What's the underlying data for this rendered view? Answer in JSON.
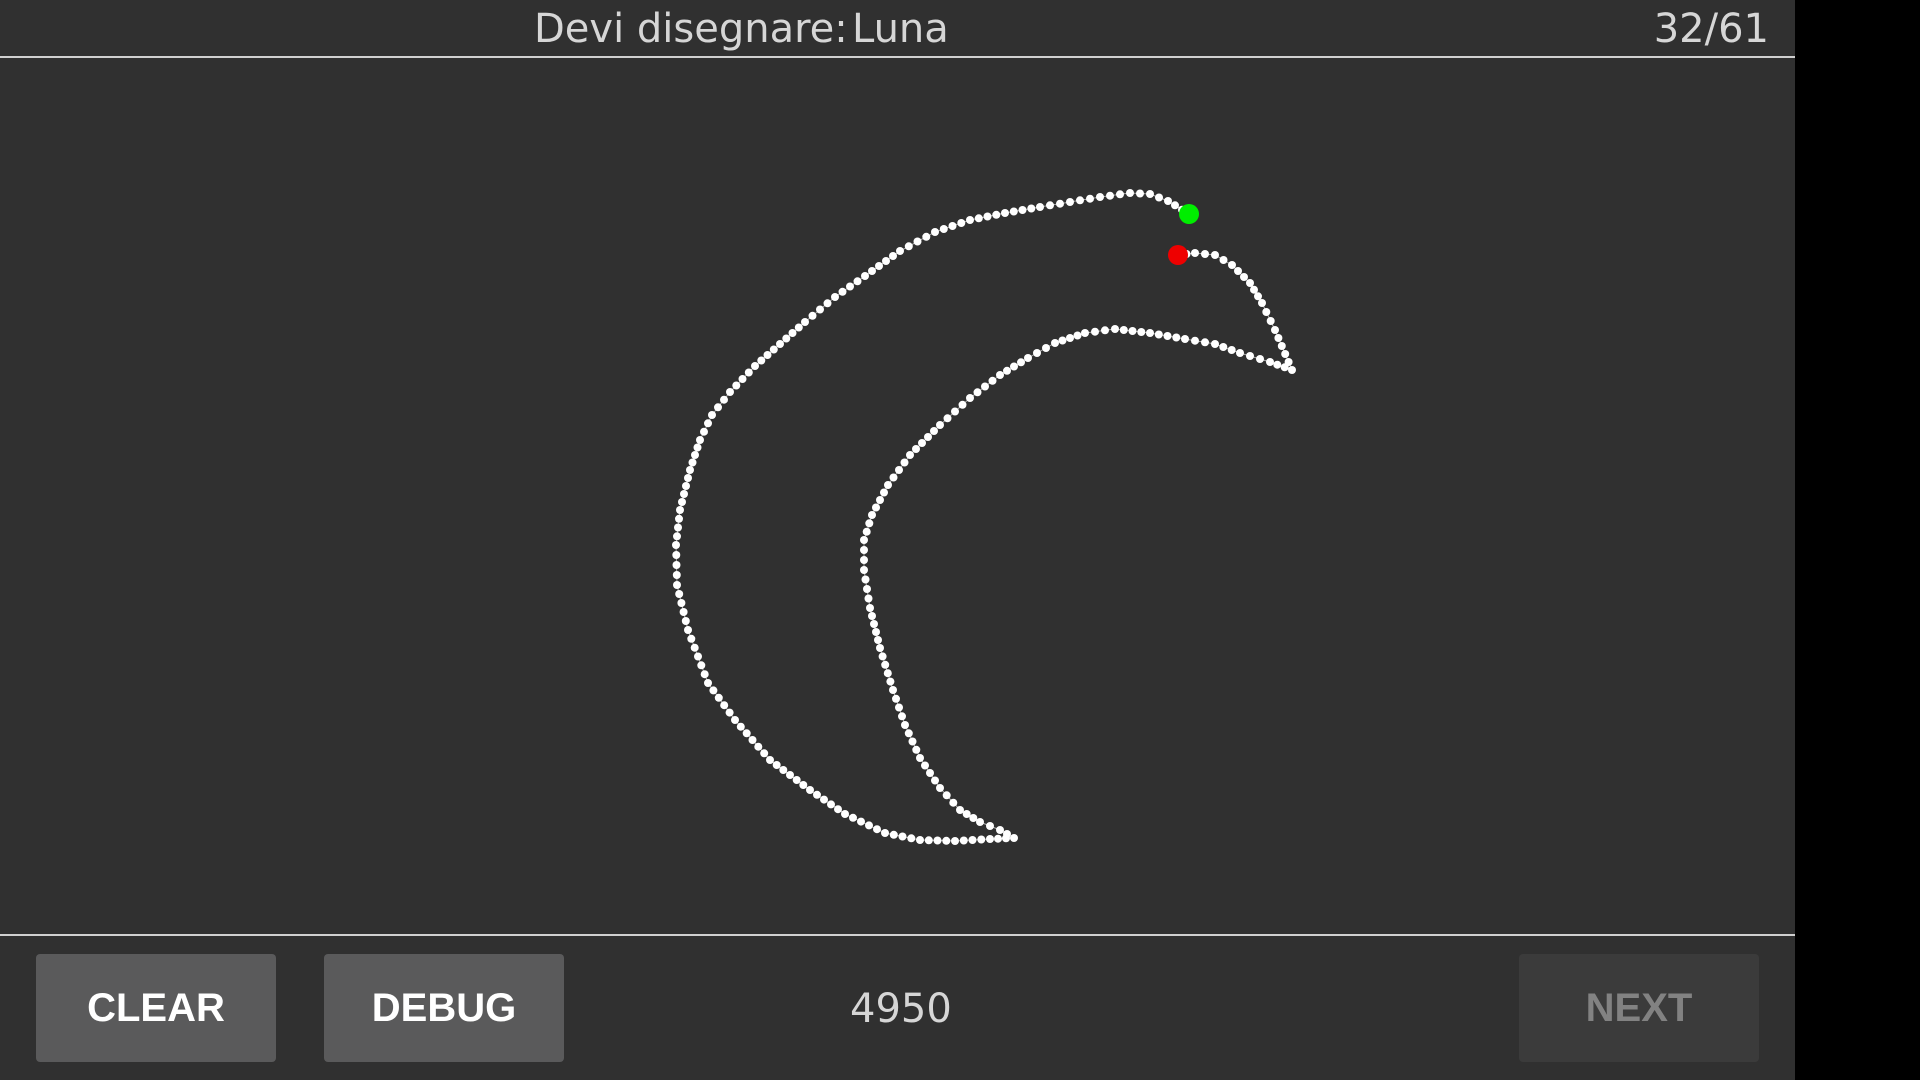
{
  "header": {
    "prompt_label": "Devi disegnare:",
    "target_word": "Luna",
    "progress": "32/61"
  },
  "canvas": {
    "stroke_color": "#ffffff",
    "start_marker_color": "#00ee00",
    "end_marker_color": "#ee0000"
  },
  "footer": {
    "clear_label": "CLEAR",
    "debug_label": "DEBUG",
    "score": "4950",
    "next_label": "NEXT"
  },
  "colors": {
    "background": "#303030",
    "divider": "#d0d0d0",
    "button_enabled": "#5a5a5b",
    "button_disabled": "#3b3b3b"
  }
}
